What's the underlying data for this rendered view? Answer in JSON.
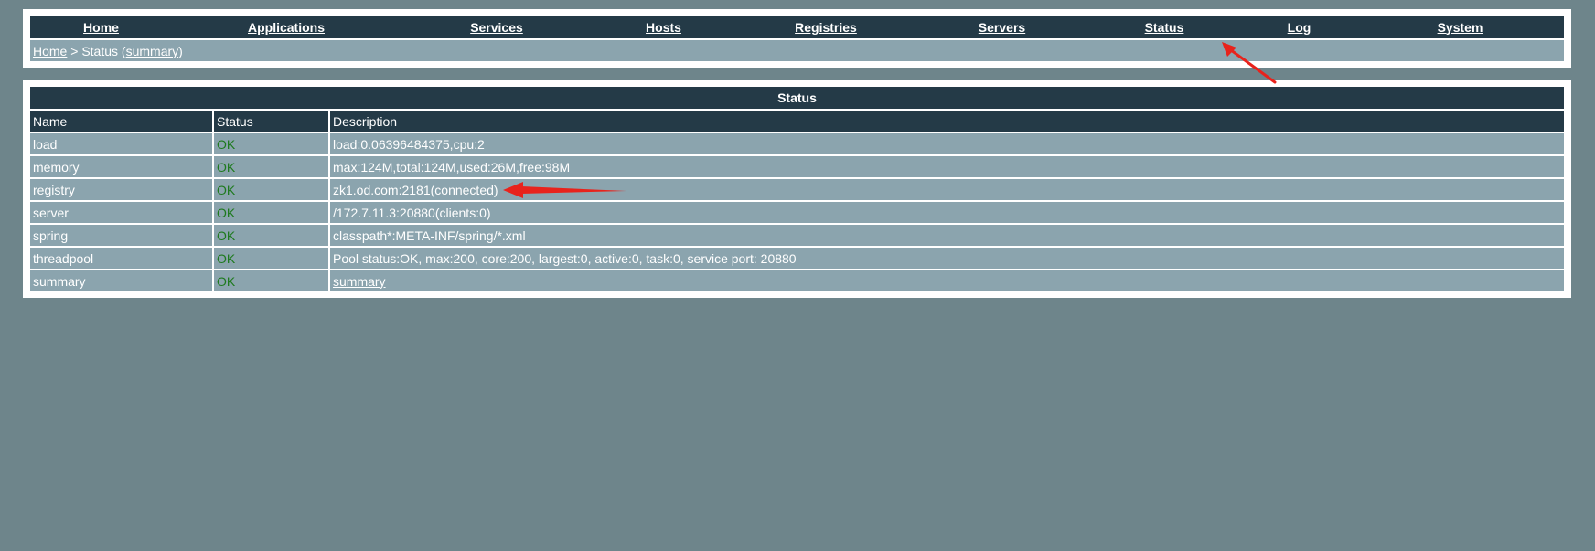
{
  "nav": {
    "items": [
      {
        "label": "Home"
      },
      {
        "label": "Applications"
      },
      {
        "label": "Services"
      },
      {
        "label": "Hosts"
      },
      {
        "label": "Registries"
      },
      {
        "label": "Servers"
      },
      {
        "label": "Status"
      },
      {
        "label": "Log"
      },
      {
        "label": "System"
      }
    ]
  },
  "breadcrumb": {
    "home": "Home",
    "sep": " > ",
    "current": "Status (",
    "summary_link": "summary",
    "close": ")"
  },
  "status_table": {
    "title": "Status",
    "headers": [
      "Name",
      "Status",
      "Description"
    ],
    "rows": [
      {
        "name": "load",
        "status": "OK",
        "description": "load:0.06396484375,cpu:2"
      },
      {
        "name": "memory",
        "status": "OK",
        "description": "max:124M,total:124M,used:26M,free:98M"
      },
      {
        "name": "registry",
        "status": "OK",
        "description": "zk1.od.com:2181(connected)"
      },
      {
        "name": "server",
        "status": "OK",
        "description": "/172.7.11.3:20880(clients:0)"
      },
      {
        "name": "spring",
        "status": "OK",
        "description": "classpath*:META-INF/spring/*.xml"
      },
      {
        "name": "threadpool",
        "status": "OK",
        "description": "Pool status:OK, max:200, core:200, largest:0, active:0, task:0, service port: 20880"
      },
      {
        "name": "summary",
        "status": "OK",
        "description": "summary"
      }
    ]
  },
  "colors": {
    "background": "#6e858b",
    "header": "#243a47",
    "row": "#8ba4ae",
    "ok": "#1e7a1e",
    "annotation": "#e8231c"
  }
}
